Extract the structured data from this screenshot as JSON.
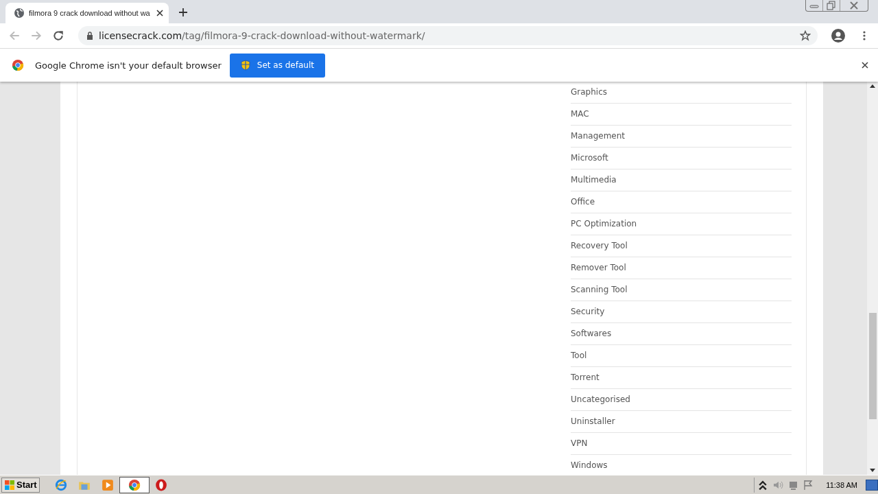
{
  "tabs": [
    {
      "title": "filmora 9 crack download without wa",
      "selected": true
    }
  ],
  "address_bar": {
    "domain": "licensecrack.com",
    "path": "/tag/filmora-9-crack-download-without-watermark/"
  },
  "infobar": {
    "message": "Google Chrome isn't your default browser",
    "button": "Set as default"
  },
  "categories": [
    "Graphics",
    "MAC",
    "Management",
    "Microsoft",
    "Multimedia",
    "Office",
    "PC Optimization",
    "Recovery Tool",
    "Remover Tool",
    "Scanning Tool",
    "Security",
    "Softwares",
    "Tool",
    "Torrent",
    "Uncategorised",
    "Uninstaller",
    "VPN",
    "Windows"
  ],
  "taskbar": {
    "start": "Start",
    "clock": "11:38 AM"
  }
}
